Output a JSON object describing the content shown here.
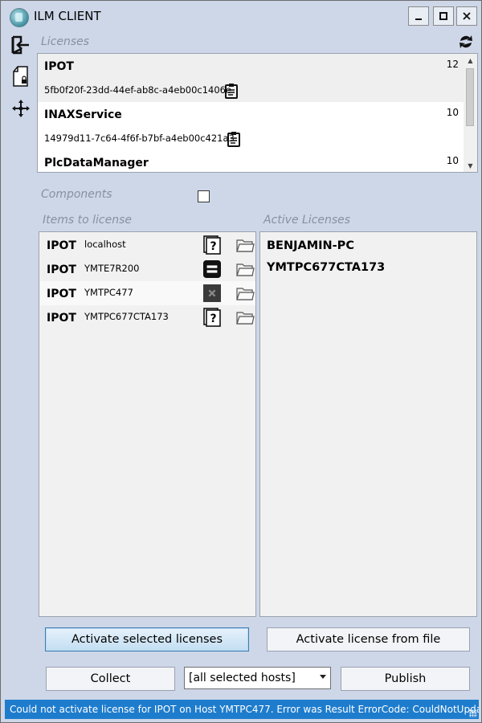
{
  "window": {
    "title": "ILM CLIENT"
  },
  "titlebar": {
    "minimize_label": "–",
    "maximize_label": "☐",
    "close_label": "✕"
  },
  "sidebar": {
    "icons": [
      "logout-icon",
      "license-file-icon",
      "move-arrows-icon"
    ]
  },
  "licenses": {
    "label": "Licenses",
    "items": [
      {
        "name": "IPOT",
        "count": "12",
        "guid": "5fb0f20f-23dd-44ef-ab8c-a4eb00c1406e"
      },
      {
        "name": "INAXService",
        "count": "10",
        "guid": "14979d11-7c64-4f6f-b7bf-a4eb00c421a3"
      },
      {
        "name": "PlcDataManager",
        "count": "10",
        "guid": ""
      }
    ]
  },
  "components": {
    "label": "Components",
    "checked": false
  },
  "items_to_license": {
    "label": "Items to license",
    "rows": [
      {
        "product": "IPOT",
        "host": "localhost",
        "status_icon": "question-docs-icon"
      },
      {
        "product": "IPOT",
        "host": "YMTE7R200",
        "status_icon": "equals-icon"
      },
      {
        "product": "IPOT",
        "host": "YMTPC477",
        "status_icon": "error-x-icon"
      },
      {
        "product": "IPOT",
        "host": "YMTPC677CTA173",
        "status_icon": "question-docs-icon"
      }
    ]
  },
  "active_licenses": {
    "label": "Active Licenses",
    "items": [
      "BENJAMIN-PC",
      "YMTPC677CTA173"
    ]
  },
  "buttons": {
    "activate_selected": "Activate selected licenses",
    "activate_from_file": "Activate license from file",
    "collect": "Collect",
    "publish": "Publish"
  },
  "host_select": {
    "value": "[all selected hosts]"
  },
  "status": {
    "message": "Could not activate license for IPOT on Host YMTPC477. Error was Result ErrorCode:  CouldNotUpdateLicense"
  },
  "colors": {
    "window_bg": "#cdd7e8",
    "status_bar": "#1e7ccd",
    "accent_button": "#c3def2"
  }
}
